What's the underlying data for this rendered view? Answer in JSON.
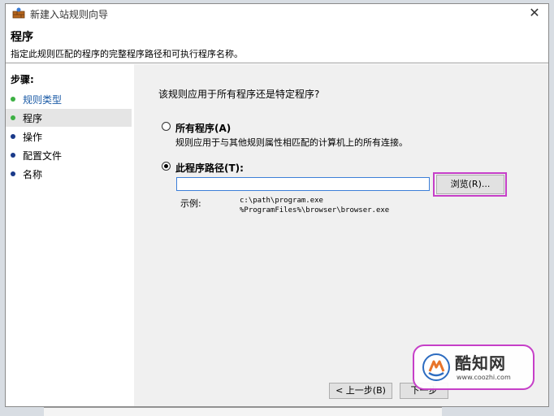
{
  "window": {
    "title": "新建入站规则向导",
    "close_glyph": "✕"
  },
  "header": {
    "title": "程序",
    "subtitle": "指定此规则匹配的程序的完整程序路径和可执行程序名称。"
  },
  "sidebar": {
    "steps_label": "步骤:",
    "items": [
      {
        "label": "规则类型",
        "state": "done"
      },
      {
        "label": "程序",
        "state": "current"
      },
      {
        "label": "操作",
        "state": "pending"
      },
      {
        "label": "配置文件",
        "state": "pending"
      },
      {
        "label": "名称",
        "state": "pending"
      }
    ]
  },
  "main": {
    "question": "该规则应用于所有程序还是特定程序?",
    "option_all": {
      "label": "所有程序(A)",
      "description": "规则应用于与其他规则属性相匹配的计算机上的所有连接。",
      "checked": false
    },
    "option_path": {
      "label": "此程序路径(T):",
      "checked": true
    },
    "path_input": {
      "value": ""
    },
    "browse_label": "浏览(R)...",
    "example_label": "示例:",
    "example_paths": [
      "c:\\path\\program.exe",
      "%ProgramFiles%\\browser\\browser.exe"
    ],
    "back_label": "< 上一步(B)",
    "next_label": "下一步"
  },
  "watermark": {
    "name": "酷知网",
    "url": "www.coozhi.com"
  },
  "colors": {
    "accent": "#c63fc8",
    "done_dot": "#3cb043",
    "pending_dot": "#1a3a8a",
    "link": "#1a5aa6"
  }
}
